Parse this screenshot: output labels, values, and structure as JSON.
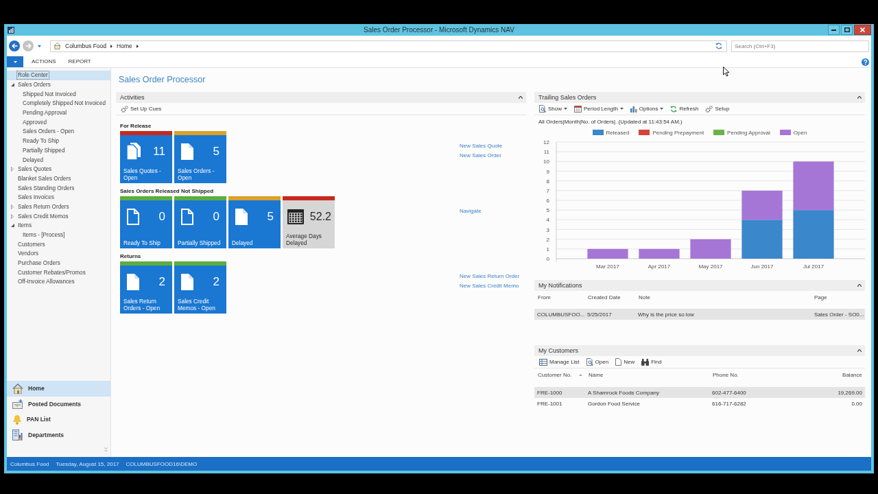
{
  "window": {
    "title": "Sales Order Processor - Microsoft Dynamics NAV"
  },
  "address_bar": {
    "breadcrumbs": [
      "Columbus Food",
      "Home"
    ],
    "search": {
      "placeholder": "Search (Ctrl+F3)"
    }
  },
  "ribbon": {
    "tabs": [
      {
        "label": "ACTIONS",
        "selected": false
      },
      {
        "label": "REPORT",
        "selected": false
      }
    ]
  },
  "navigation": {
    "items": [
      {
        "label": "Role Center",
        "selected": true
      },
      {
        "label": "Sales Orders",
        "selected": false,
        "expanded": true,
        "children": [
          {
            "label": "Shipped Not Invoiced",
            "selected": false
          },
          {
            "label": "Completely Shipped Not Invoiced",
            "selected": false
          },
          {
            "label": "Pending Approval",
            "selected": false
          },
          {
            "label": "Approved",
            "selected": false
          },
          {
            "label": "Sales Orders - Open",
            "selected": false
          },
          {
            "label": "Ready To Ship",
            "selected": false
          },
          {
            "label": "Partially Shipped",
            "selected": false
          },
          {
            "label": "Delayed",
            "selected": false
          }
        ]
      },
      {
        "label": "Sales Quotes",
        "selected": false,
        "expanded": false
      },
      {
        "label": "Blanket Sales Orders",
        "selected": false
      },
      {
        "label": "Sales Standing Orders",
        "selected": false
      },
      {
        "label": "Sales Invoices",
        "selected": false
      },
      {
        "label": "Sales Return Orders",
        "selected": false,
        "expanded": false
      },
      {
        "label": "Sales Credit Memos",
        "selected": false,
        "expanded": false
      },
      {
        "label": "Items",
        "selected": false,
        "expanded": true,
        "children": [
          {
            "label": "Items - [Process]",
            "selected": false
          }
        ]
      },
      {
        "label": "Customers",
        "selected": false
      },
      {
        "label": "Vendors",
        "selected": false
      },
      {
        "label": "Purchase Orders",
        "selected": false
      },
      {
        "label": "Customer Rebates/Promos",
        "selected": false
      },
      {
        "label": "Off-Invoice Allowances",
        "selected": false
      }
    ],
    "departments": [
      {
        "label": "Home",
        "selected": true
      },
      {
        "label": "Posted Documents",
        "selected": false
      },
      {
        "label": "PAN List",
        "selected": false
      },
      {
        "label": "Departments",
        "selected": false
      }
    ]
  },
  "page": {
    "title": "Sales Order Processor"
  },
  "activities": {
    "title": "Activities",
    "expanded": true,
    "actions": [
      "Set Up Cues"
    ],
    "groups": [
      {
        "title": "For Release",
        "tiles": [
          {
            "label": "Sales Quotes - Open",
            "value": "11",
            "kind": "stack",
            "color": "#c8281e"
          },
          {
            "label": "Sales Orders - Open",
            "value": "5",
            "kind": "filled",
            "color": "#dba128"
          }
        ],
        "links": [
          "New Sales Quote",
          "New Sales Order"
        ]
      },
      {
        "title": "Sales Orders Released Not Shipped",
        "tiles": [
          {
            "label": "Ready To Ship",
            "value": "0",
            "kind": "outline",
            "color": "#5cae3e"
          },
          {
            "label": "Partially Shipped",
            "value": "0",
            "kind": "outline",
            "color": "#5cae3e"
          },
          {
            "label": "Delayed",
            "value": "5",
            "kind": "filled",
            "color": "#dba128"
          },
          {
            "label": "Average Days Delayed",
            "value": "52.2",
            "kind": "calendar",
            "color": "#c8281e"
          }
        ],
        "links": [
          "Navigate"
        ]
      },
      {
        "title": "Returns",
        "tiles": [
          {
            "label": "Sales Return Orders - Open",
            "value": "2",
            "kind": "filled",
            "color": "#5cae3e"
          },
          {
            "label": "Sales Credit Memos - Open",
            "value": "2",
            "kind": "filled",
            "color": "#5cae3e"
          }
        ],
        "links": [
          "New Sales Return Order",
          "New Sales Credit Memo"
        ]
      }
    ]
  },
  "trailing_sales_orders": {
    "title": "Trailing Sales Orders",
    "expanded": true,
    "toolbar": [
      {
        "label": "Show",
        "kind": "menu"
      },
      {
        "label": "Period Length",
        "kind": "menu"
      },
      {
        "label": "Options",
        "kind": "menu"
      },
      {
        "label": "Refresh",
        "kind": "button"
      },
      {
        "label": "Setup",
        "kind": "button"
      }
    ],
    "caption": "All Orders|Month|No. of Orders|. (Updated at 11:43:54 AM.)",
    "chart_data": [
      {
        "type": "bar",
        "stacked": true,
        "legend": "top",
        "grid": true,
        "categories": [
          "Mar 2017",
          "Apr 2017",
          "May 2017",
          "Jun 2017",
          "Jul 2017"
        ],
        "ylim": [
          0,
          12
        ],
        "yticks": [
          0,
          1,
          2,
          3,
          4,
          5,
          6,
          7,
          8,
          9,
          10,
          11,
          12
        ],
        "series": [
          {
            "name": "Released",
            "color": "#3a87cc",
            "values": [
              0,
              0,
              0,
              4,
              5
            ]
          },
          {
            "name": "Pending Prepayment",
            "color": "#d5433a",
            "values": [
              0,
              0,
              0,
              0,
              0
            ]
          },
          {
            "name": "Pending Approval",
            "color": "#6cb24c",
            "values": [
              0,
              0,
              0,
              0,
              0
            ]
          },
          {
            "name": "Open",
            "color": "#a676d6",
            "values": [
              1,
              1,
              2,
              3,
              5
            ]
          }
        ]
      }
    ]
  },
  "my_notifications": {
    "title": "My Notifications",
    "expanded": true,
    "columns": [
      "From",
      "Created Date",
      "Note",
      "Page"
    ],
    "rows": [
      {
        "cells": [
          "COLUMBUSFOO...",
          "5/25/2017",
          "Why is the price so low",
          "Sales Order - SO0..."
        ],
        "selected": true
      }
    ]
  },
  "my_customers": {
    "title": "My Customers",
    "expanded": true,
    "toolbar": [
      "Manage List",
      "Open",
      "New",
      "Find"
    ],
    "columns": [
      {
        "label": "Customer No.",
        "sorted": true
      },
      {
        "label": "Name",
        "sorted": false
      },
      {
        "label": "Phone No.",
        "sorted": false
      },
      {
        "label": "Balance",
        "sorted": false
      }
    ],
    "rows": [
      {
        "cells": [
          "FRE-1000",
          "A Shamrock Foods Company",
          "602-477-6400",
          "19,269.00"
        ],
        "selected": true
      },
      {
        "cells": [
          "FRE-1001",
          "Gordon Food Service",
          "616-717-6282",
          "0.00"
        ],
        "selected": false
      }
    ]
  },
  "status_bar": [
    "Columbus Food",
    "Tuesday, August 15, 2017",
    "COLUMBUSFOOD16\\DEMO"
  ]
}
